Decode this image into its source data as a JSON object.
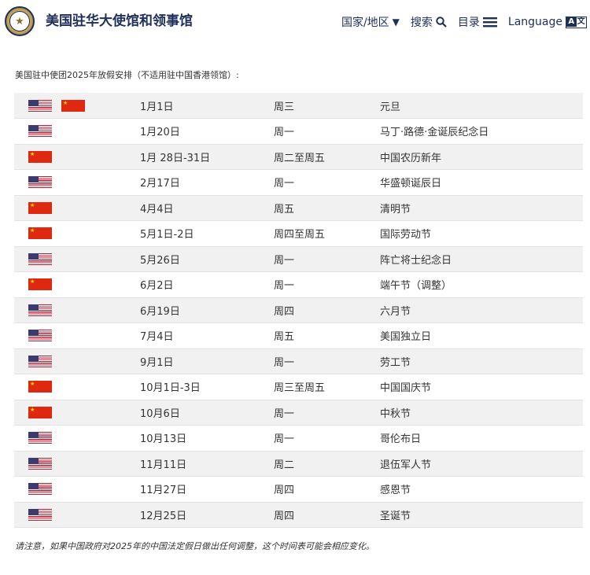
{
  "header": {
    "site_title": "美国驻华大使馆和领事馆",
    "seal_icon": "embassy-seal-icon",
    "nav": {
      "country": "国家/地区",
      "search": "搜索",
      "menu": "目录",
      "language": "Language"
    }
  },
  "intro": "美国驻中使团2025年放假安排（不适用驻中国香港领馆）:",
  "colors": {
    "navy": "#1e2f5a",
    "us_red": "#b22234",
    "us_blue": "#3c3b6e",
    "cn_red": "#de2910",
    "cn_star": "#ffde00"
  },
  "holidays": [
    {
      "flags": [
        "us",
        "cn"
      ],
      "date": "1月1日",
      "weekday": "周三",
      "name": "元旦"
    },
    {
      "flags": [
        "us"
      ],
      "date": "1月20日",
      "weekday": "周一",
      "name": "马丁·路德·金诞辰纪念日"
    },
    {
      "flags": [
        "cn"
      ],
      "date": "1月 28日-31日",
      "weekday": "周二至周五",
      "name": "中国农历新年"
    },
    {
      "flags": [
        "us"
      ],
      "date": "2月17日",
      "weekday": "周一",
      "name": "华盛顿诞辰日"
    },
    {
      "flags": [
        "cn"
      ],
      "date": "4月4日",
      "weekday": "周五",
      "name": "清明节"
    },
    {
      "flags": [
        "cn"
      ],
      "date": "5月1日-2日",
      "weekday": "周四至周五",
      "name": "国际劳动节"
    },
    {
      "flags": [
        "us"
      ],
      "date": "5月26日",
      "weekday": "周一",
      "name": "阵亡将士纪念日"
    },
    {
      "flags": [
        "cn"
      ],
      "date": "6月2日",
      "weekday": "周一",
      "name": "端午节（调整）"
    },
    {
      "flags": [
        "us"
      ],
      "date": "6月19日",
      "weekday": "周四",
      "name": "六月节"
    },
    {
      "flags": [
        "us"
      ],
      "date": "7月4日",
      "weekday": "周五",
      "name": "美国独立日"
    },
    {
      "flags": [
        "us"
      ],
      "date": "9月1日",
      "weekday": "周一",
      "name": "劳工节"
    },
    {
      "flags": [
        "cn"
      ],
      "date": "10月1日-3日",
      "weekday": "周三至周五",
      "name": "中国国庆节"
    },
    {
      "flags": [
        "cn"
      ],
      "date": "10月6日",
      "weekday": "周一",
      "name": "中秋节"
    },
    {
      "flags": [
        "us"
      ],
      "date": "10月13日",
      "weekday": "周一",
      "name": "哥伦布日"
    },
    {
      "flags": [
        "us"
      ],
      "date": "11月11日",
      "weekday": "周二",
      "name": "退伍军人节"
    },
    {
      "flags": [
        "us"
      ],
      "date": "11月27日",
      "weekday": "周四",
      "name": "感恩节"
    },
    {
      "flags": [
        "us"
      ],
      "date": "12月25日",
      "weekday": "周四",
      "name": "圣诞节"
    }
  ],
  "note": "请注意，如果中国政府对2025年的中国法定假日做出任何调整，这个时间表可能会相应变化。"
}
